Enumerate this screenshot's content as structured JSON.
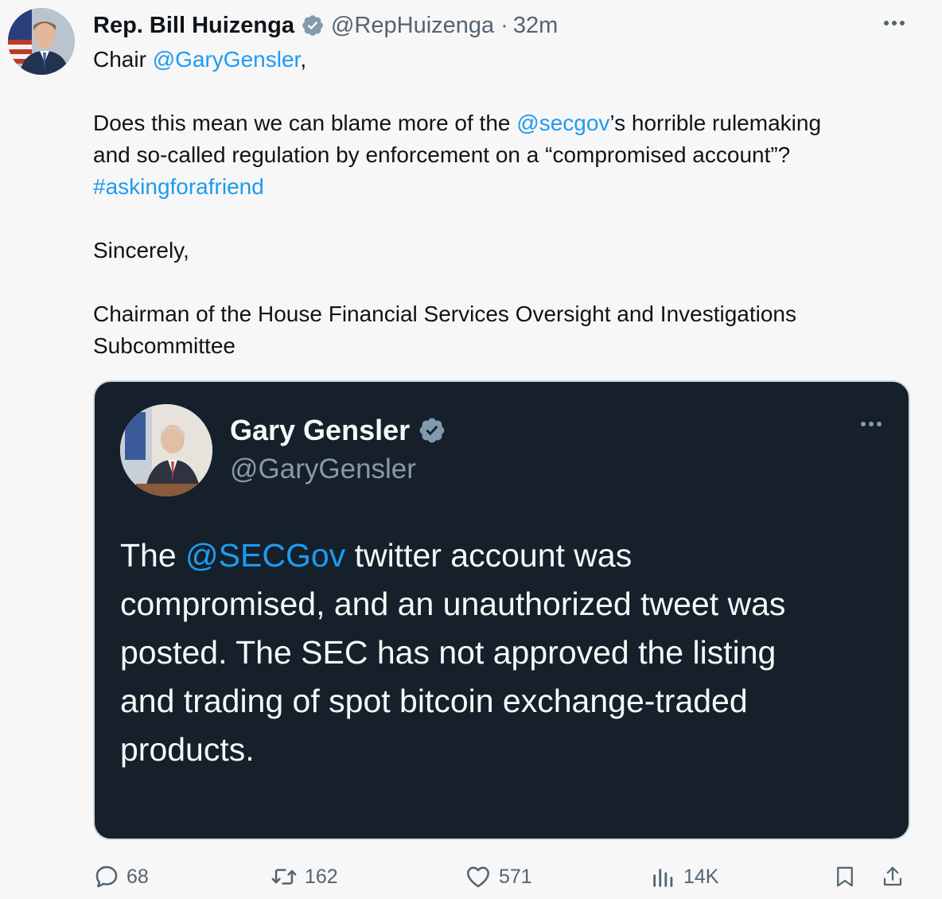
{
  "post": {
    "author": {
      "name": "Rep. Bill Huizenga",
      "handle": "@RepHuizenga",
      "separator": "·",
      "time": "32m"
    },
    "body": {
      "greeting_prefix": "Chair ",
      "greeting_mention": "@GaryGensler",
      "greeting_suffix": ",",
      "p2_l1_prefix": "Does this mean we can blame more of the ",
      "p2_l1_mention": "@secgov",
      "p2_l1_suffix": "’s horrible rulemaking",
      "p2_l2": "and so-called regulation by enforcement on a “compromised account”?",
      "p2_hashtag": "#askingforafriend",
      "closing": "Sincerely,",
      "sig_l1": "Chairman of the House Financial Services Oversight and Investigations",
      "sig_l2": "Subcommittee"
    },
    "quote": {
      "name": "Gary Gensler",
      "handle": "@GaryGensler",
      "l1_prefix": "The ",
      "l1_mention": "@SECGov",
      "l1_suffix": " twitter account was",
      "l2": "compromised, and an unauthorized tweet was",
      "l3": "posted. The SEC has not approved the listing",
      "l4": "and trading of spot bitcoin exchange-traded",
      "l5": "products."
    },
    "actions": {
      "replies": "68",
      "reposts": "162",
      "likes": "571",
      "views": "14K"
    }
  },
  "icons": {
    "verified": "verified-badge-icon",
    "more": "more-options-icon",
    "reply": "reply-icon",
    "repost": "repost-icon",
    "like": "heart-icon",
    "views": "views-icon",
    "bookmark": "bookmark-icon",
    "share": "share-icon"
  },
  "colors": {
    "link": "#1d9bf0",
    "quote_bg": "#15202b",
    "muted": "#536471"
  }
}
